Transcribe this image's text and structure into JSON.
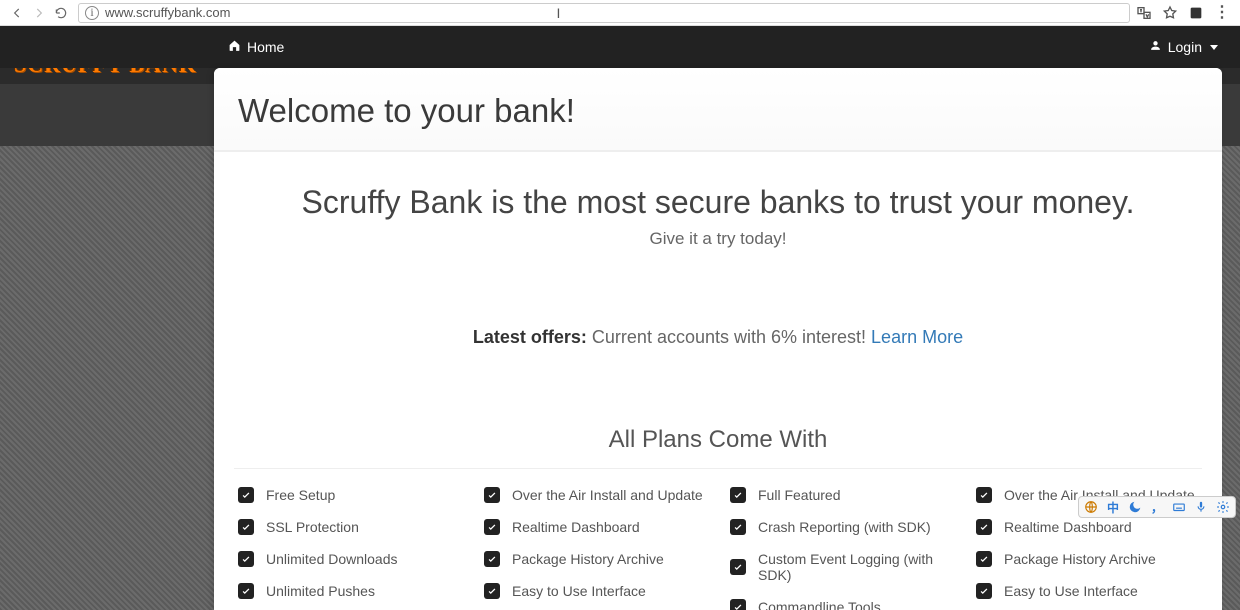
{
  "browser": {
    "url": "www.scruffybank.com"
  },
  "brand": "SCRUFFY BANK",
  "nav": {
    "home_label": "Home",
    "login_label": "Login"
  },
  "page": {
    "heading": "Welcome to your bank!",
    "hero_title": "Scruffy Bank is the most secure banks to trust your money.",
    "hero_sub": "Give it a try today!",
    "offers_bold": "Latest offers:",
    "offers_text": " Current accounts with 6% interest! ",
    "offers_link": "Learn More",
    "plans_title": "All Plans Come With"
  },
  "plans": {
    "col1": [
      "Free Setup",
      "SSL Protection",
      "Unlimited Downloads",
      "Unlimited Pushes"
    ],
    "col2": [
      "Over the Air Install and Update",
      "Realtime Dashboard",
      "Package History Archive",
      "Easy to Use Interface"
    ],
    "col3": [
      "Full Featured",
      "Crash Reporting (with SDK)",
      "Custom Event Logging (with SDK)",
      "Commandline Tools"
    ],
    "col4": [
      "Over the Air Install and Update",
      "Realtime Dashboard",
      "Package History Archive",
      "Easy to Use Interface"
    ]
  }
}
